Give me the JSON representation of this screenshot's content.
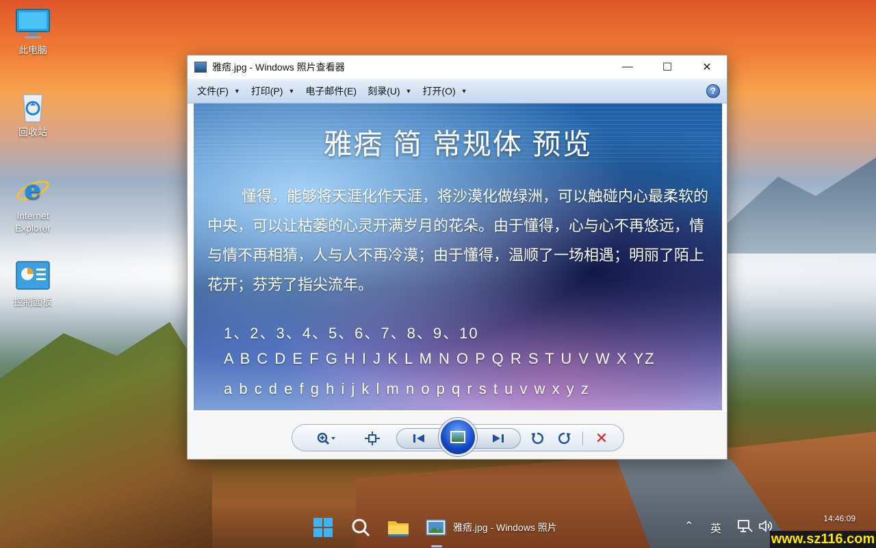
{
  "desktop": {
    "icons": [
      {
        "label": "此电脑",
        "icon": "monitor-icon"
      },
      {
        "label": "回收站",
        "icon": "recycle-bin-icon"
      },
      {
        "label": "Internet Explorer",
        "icon": "internet-explorer-icon"
      },
      {
        "label": "控制面板",
        "icon": "control-panel-icon"
      }
    ]
  },
  "window": {
    "title": "雅痞.jpg - Windows 照片查看器",
    "minimize": "—",
    "maximize": "☐",
    "close": "✕",
    "menu": [
      {
        "label": "文件(F)",
        "has_dropdown": true
      },
      {
        "label": "打印(P)",
        "has_dropdown": true
      },
      {
        "label": "电子邮件(E)",
        "has_dropdown": false
      },
      {
        "label": "刻录(U)",
        "has_dropdown": true
      },
      {
        "label": "打开(O)",
        "has_dropdown": true
      }
    ],
    "help": "?"
  },
  "image": {
    "heading": "雅痞 简 常规体 预览",
    "paragraph": "懂得，能够将天涯化作天涯，将沙漠化做绿洲，可以触碰内心最柔软的中央，可以让枯萎的心灵开满岁月的花朵。由于懂得，心与心不再悠远，情与情不再相猜，人与人不再冷漠；由于懂得，温顺了一场相遇；明丽了陌上花开；芬芳了指尖流年。",
    "numbers": "1、2、3、4、5、6、7、8、9、10",
    "uppercase": "A B C D E F G H I J K L M N O P Q R S T U V W X YZ",
    "lowercase": "a b c d e f g h i j k l m n o p q r s t u v w x y z"
  },
  "taskbar": {
    "app_label": "雅痞.jpg - Windows 照片",
    "ime": "英",
    "clock": "14:46:09"
  },
  "watermark": "www.sz116.com"
}
